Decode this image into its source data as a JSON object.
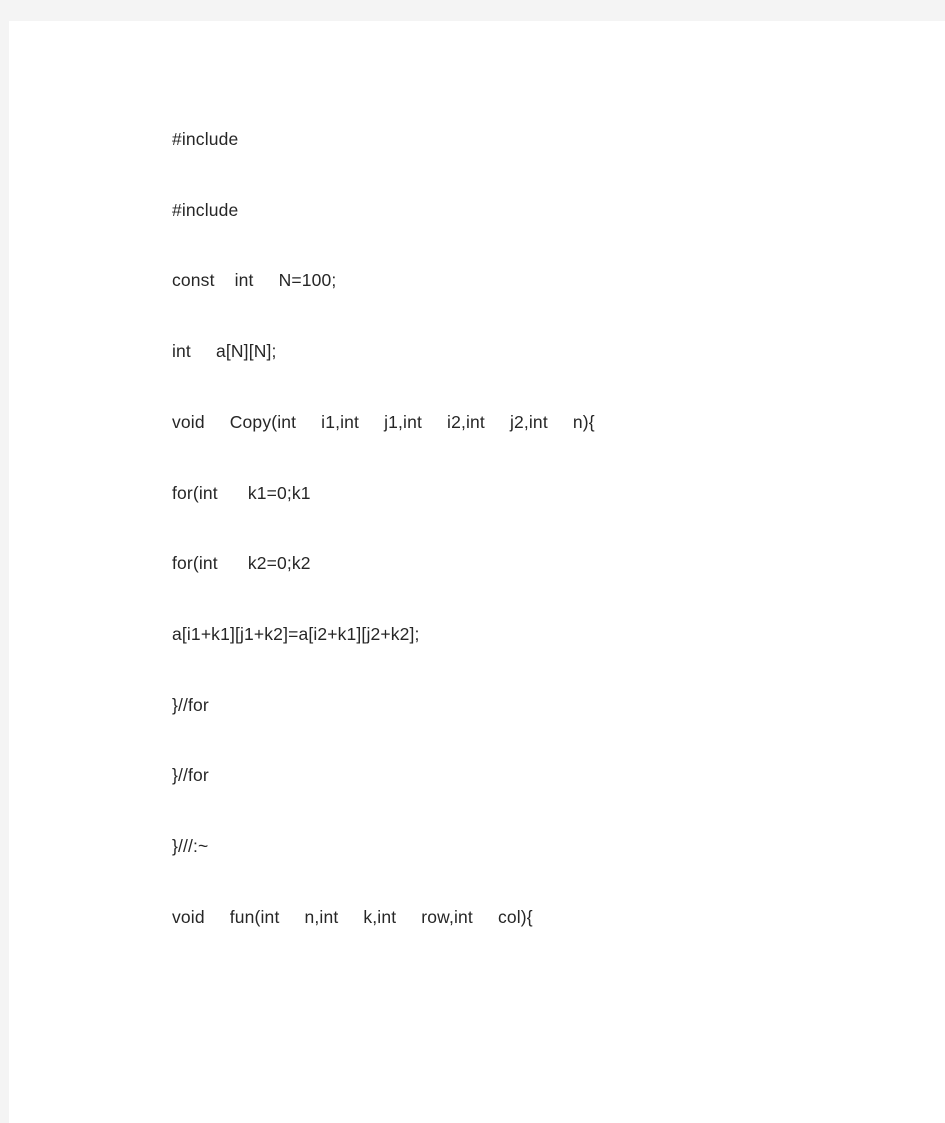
{
  "document": {
    "page_background": "#ffffff",
    "viewer_background": "#f4f4f4",
    "text_color": "#262626",
    "lines": [
      {
        "text": "#include"
      },
      {
        "text": "#include"
      },
      {
        "text": "const    int     N=100;"
      },
      {
        "text": "int     a[N][N];"
      },
      {
        "text": "void     Copy(int     i1,int     j1,int     i2,int     j2,int     n){"
      },
      {
        "text": "for(int      k1=0;k1"
      },
      {
        "text": "for(int      k2=0;k2"
      },
      {
        "text": "a[i1+k1][j1+k2]=a[i2+k1][j2+k2];"
      },
      {
        "text": "}//for"
      },
      {
        "text": "}//for"
      },
      {
        "text": "}///:~"
      },
      {
        "text": "void     fun(int     n,int     k,int     row,int     col){"
      }
    ]
  }
}
